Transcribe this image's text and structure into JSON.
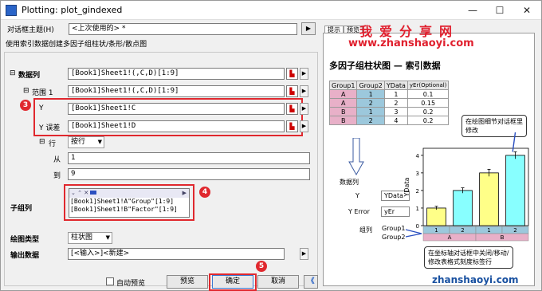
{
  "window": {
    "title": "Plotting: plot_gindexed",
    "minimize": "—",
    "maximize": "☐",
    "close": "✕"
  },
  "theme": {
    "label": "对话框主题(H)",
    "value": "<上次使用的> *",
    "arrow": "▶"
  },
  "description": "使用索引数据创建多因子组柱状/条形/散点图",
  "fields": {
    "data_columns": {
      "label": "数据列",
      "value": "[Book1]Sheet1!(,C,D)[1:9]"
    },
    "range1": {
      "label": "范围 1",
      "value": "[Book1]Sheet1!(,C,D)[1:9]"
    },
    "y": {
      "label": "Y",
      "value": "[Book1]Sheet1!C"
    },
    "y_error": {
      "label": "Y 误差",
      "value": "[Book1]Sheet1!D"
    },
    "rows": {
      "label": "行",
      "value": "按行"
    },
    "from": {
      "label": "从",
      "value": "1"
    },
    "to": {
      "label": "到",
      "value": "9"
    },
    "subgroup": {
      "label": "子组列",
      "line1": "[Book1]Sheet1!A\"Group\"[1:9]",
      "line2": "[Book1]Sheet1!B\"Factor\"[1:9]"
    },
    "plot_type": {
      "label": "绘图类型",
      "value": "柱状图"
    },
    "output": {
      "label": "输出数据",
      "value": "[<输入>]<新建>"
    }
  },
  "badges": [
    "3",
    "4",
    "5"
  ],
  "buttons": {
    "auto_preview": "自动预览",
    "preview": "预览",
    "ok": "确定",
    "cancel": "取消",
    "collapse": "《"
  },
  "tabs": [
    "提示",
    "预览"
  ],
  "watermark": {
    "chars": "我爱分享网",
    "url": "www.zhanshaoyi.com",
    "bottom": "zhanshaoyi.com"
  },
  "preview": {
    "title": "多因子组柱状图 — 索引数据",
    "table": {
      "headers": [
        "Group1",
        "Group2",
        "YData",
        "yEr(Optional)"
      ],
      "rows": [
        [
          "A",
          "1",
          "1",
          "0.1"
        ],
        [
          "A",
          "2",
          "2",
          "0.15"
        ],
        [
          "B",
          "1",
          "3",
          "0.2"
        ],
        [
          "B",
          "2",
          "4",
          "0.2"
        ]
      ]
    },
    "data_col_label": "数据列",
    "y_label": "Y",
    "yerror_label": "Y Error",
    "ydata_box": "YData",
    "yer_box": "yEr",
    "group_col_label": "组列",
    "group1_label": "Group1",
    "group2_label": "Group2",
    "note_top": "在绘图细节对话框里修改",
    "note_bottom": "在坐标轴对话框中关闭/移动/修改表格式刻度标签行",
    "axis_title": "YData",
    "yticks": [
      "0",
      "1",
      "2",
      "3",
      "4"
    ],
    "xrow1": [
      "1",
      "2",
      "1",
      "2"
    ],
    "xrow2": [
      "A",
      "B"
    ]
  },
  "chart_data": {
    "type": "bar",
    "categories": [
      "A-1",
      "A-2",
      "B-1",
      "B-2"
    ],
    "series": [
      {
        "values": [
          1,
          2,
          3,
          4
        ],
        "errors": [
          0.1,
          0.15,
          0.2,
          0.2
        ]
      }
    ],
    "ylabel": "YData",
    "ylim": [
      0,
      4.4
    ]
  },
  "colors": {
    "bar1": "#ffff88",
    "bar2": "#88ffff",
    "red": "#e0282e",
    "pink": "#e8b0c8",
    "blue": "#9cc8dc"
  }
}
